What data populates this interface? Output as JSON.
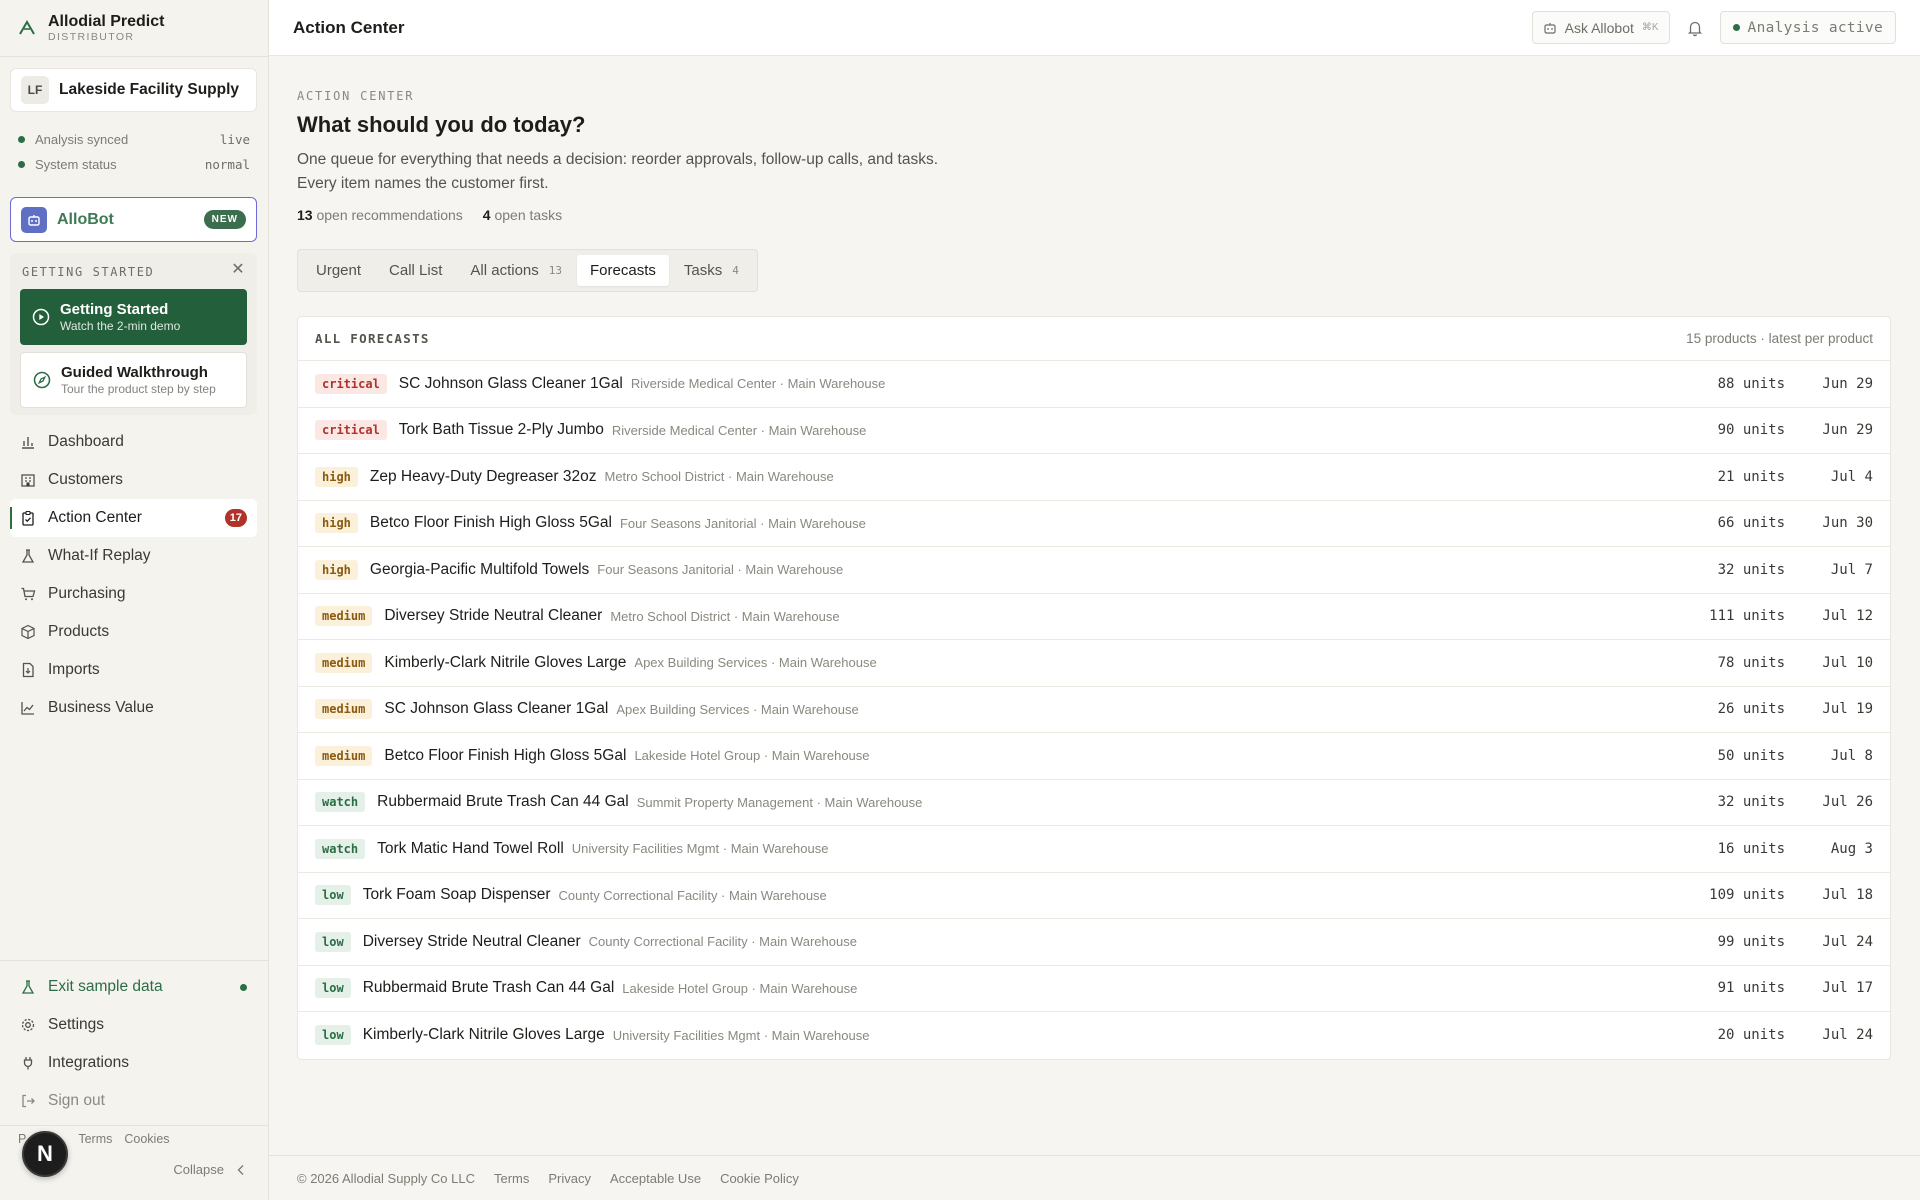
{
  "brand": {
    "name": "Allodial Predict",
    "sub": "DISTRIBUTOR"
  },
  "org": {
    "initials": "LF",
    "name": "Lakeside Facility Supply"
  },
  "status": [
    {
      "label": "Analysis synced",
      "value": "live"
    },
    {
      "label": "System status",
      "value": "normal"
    }
  ],
  "allobot": {
    "label": "AlloBot",
    "badge": "NEW"
  },
  "getting_started": {
    "title": "GETTING STARTED",
    "primary": {
      "title": "Getting Started",
      "sub": "Watch the 2-min demo"
    },
    "secondary": {
      "title": "Guided Walkthrough",
      "sub": "Tour the product step by step"
    }
  },
  "nav": [
    {
      "label": "Dashboard",
      "icon": "bar-chart-icon"
    },
    {
      "label": "Customers",
      "icon": "building-icon"
    },
    {
      "label": "Action Center",
      "icon": "clipboard-check-icon",
      "count": "17",
      "active": true
    },
    {
      "label": "What-If Replay",
      "icon": "flask-icon"
    },
    {
      "label": "Purchasing",
      "icon": "cart-icon"
    },
    {
      "label": "Products",
      "icon": "box-icon"
    },
    {
      "label": "Imports",
      "icon": "file-import-icon"
    },
    {
      "label": "Business Value",
      "icon": "line-chart-icon"
    }
  ],
  "nav_bottom": {
    "exit": "Exit sample data",
    "settings": "Settings",
    "integrations": "Integrations",
    "signout": "Sign out"
  },
  "sidebar_links": {
    "p": "P",
    "terms": "Terms",
    "cookies": "Cookies"
  },
  "avatar": "N",
  "collapse": "Collapse",
  "topbar": {
    "title": "Action Center",
    "ask": "Ask Allobot",
    "ask_kbd": "⌘K",
    "analysis": "Analysis active"
  },
  "main": {
    "eyebrow": "ACTION CENTER",
    "headline": "What should you do today?",
    "desc_1": "One queue for everything that needs a decision: reorder approvals, follow-up calls, and tasks.",
    "desc_2": "Every item names the customer first.",
    "rec_count": "13",
    "rec_label": "open recommendations",
    "task_count": "4",
    "task_label": "open tasks"
  },
  "tabs": [
    {
      "label": "Urgent"
    },
    {
      "label": "Call List"
    },
    {
      "label": "All actions",
      "count": "13"
    },
    {
      "label": "Forecasts",
      "active": true
    },
    {
      "label": "Tasks",
      "count": "4"
    }
  ],
  "forecasts": {
    "title": "ALL FORECASTS",
    "meta": "15 products · latest per product",
    "rows": [
      {
        "priority": "critical",
        "product": "SC Johnson Glass Cleaner 1Gal",
        "customer": "Riverside Medical Center · Main Warehouse",
        "units": "88 units",
        "date": "Jun 29"
      },
      {
        "priority": "critical",
        "product": "Tork Bath Tissue 2-Ply Jumbo",
        "customer": "Riverside Medical Center · Main Warehouse",
        "units": "90 units",
        "date": "Jun 29"
      },
      {
        "priority": "high",
        "product": "Zep Heavy-Duty Degreaser 32oz",
        "customer": "Metro School District · Main Warehouse",
        "units": "21 units",
        "date": "Jul 4"
      },
      {
        "priority": "high",
        "product": "Betco Floor Finish High Gloss 5Gal",
        "customer": "Four Seasons Janitorial · Main Warehouse",
        "units": "66 units",
        "date": "Jun 30"
      },
      {
        "priority": "high",
        "product": "Georgia-Pacific Multifold Towels",
        "customer": "Four Seasons Janitorial · Main Warehouse",
        "units": "32 units",
        "date": "Jul 7"
      },
      {
        "priority": "medium",
        "product": "Diversey Stride Neutral Cleaner",
        "customer": "Metro School District · Main Warehouse",
        "units": "111 units",
        "date": "Jul 12"
      },
      {
        "priority": "medium",
        "product": "Kimberly-Clark Nitrile Gloves Large",
        "customer": "Apex Building Services · Main Warehouse",
        "units": "78 units",
        "date": "Jul 10"
      },
      {
        "priority": "medium",
        "product": "SC Johnson Glass Cleaner 1Gal",
        "customer": "Apex Building Services · Main Warehouse",
        "units": "26 units",
        "date": "Jul 19"
      },
      {
        "priority": "medium",
        "product": "Betco Floor Finish High Gloss 5Gal",
        "customer": "Lakeside Hotel Group · Main Warehouse",
        "units": "50 units",
        "date": "Jul 8"
      },
      {
        "priority": "watch",
        "product": "Rubbermaid Brute Trash Can 44 Gal",
        "customer": "Summit Property Management · Main Warehouse",
        "units": "32 units",
        "date": "Jul 26"
      },
      {
        "priority": "watch",
        "product": "Tork Matic Hand Towel Roll",
        "customer": "University Facilities Mgmt · Main Warehouse",
        "units": "16 units",
        "date": "Aug 3"
      },
      {
        "priority": "low",
        "product": "Tork Foam Soap Dispenser",
        "customer": "County Correctional Facility · Main Warehouse",
        "units": "109 units",
        "date": "Jul 18"
      },
      {
        "priority": "low",
        "product": "Diversey Stride Neutral Cleaner",
        "customer": "County Correctional Facility · Main Warehouse",
        "units": "99 units",
        "date": "Jul 24"
      },
      {
        "priority": "low",
        "product": "Rubbermaid Brute Trash Can 44 Gal",
        "customer": "Lakeside Hotel Group · Main Warehouse",
        "units": "91 units",
        "date": "Jul 17"
      },
      {
        "priority": "low",
        "product": "Kimberly-Clark Nitrile Gloves Large",
        "customer": "University Facilities Mgmt · Main Warehouse",
        "units": "20 units",
        "date": "Jul 24"
      }
    ]
  },
  "footer": {
    "copyright": "© 2026 Allodial Supply Co LLC",
    "terms": "Terms",
    "privacy": "Privacy",
    "acceptable": "Acceptable Use",
    "cookie": "Cookie Policy"
  },
  "colors": {
    "brand_green": "#2b6d45",
    "critical": "#b0322a",
    "accent_border": "#6e6ad4"
  }
}
